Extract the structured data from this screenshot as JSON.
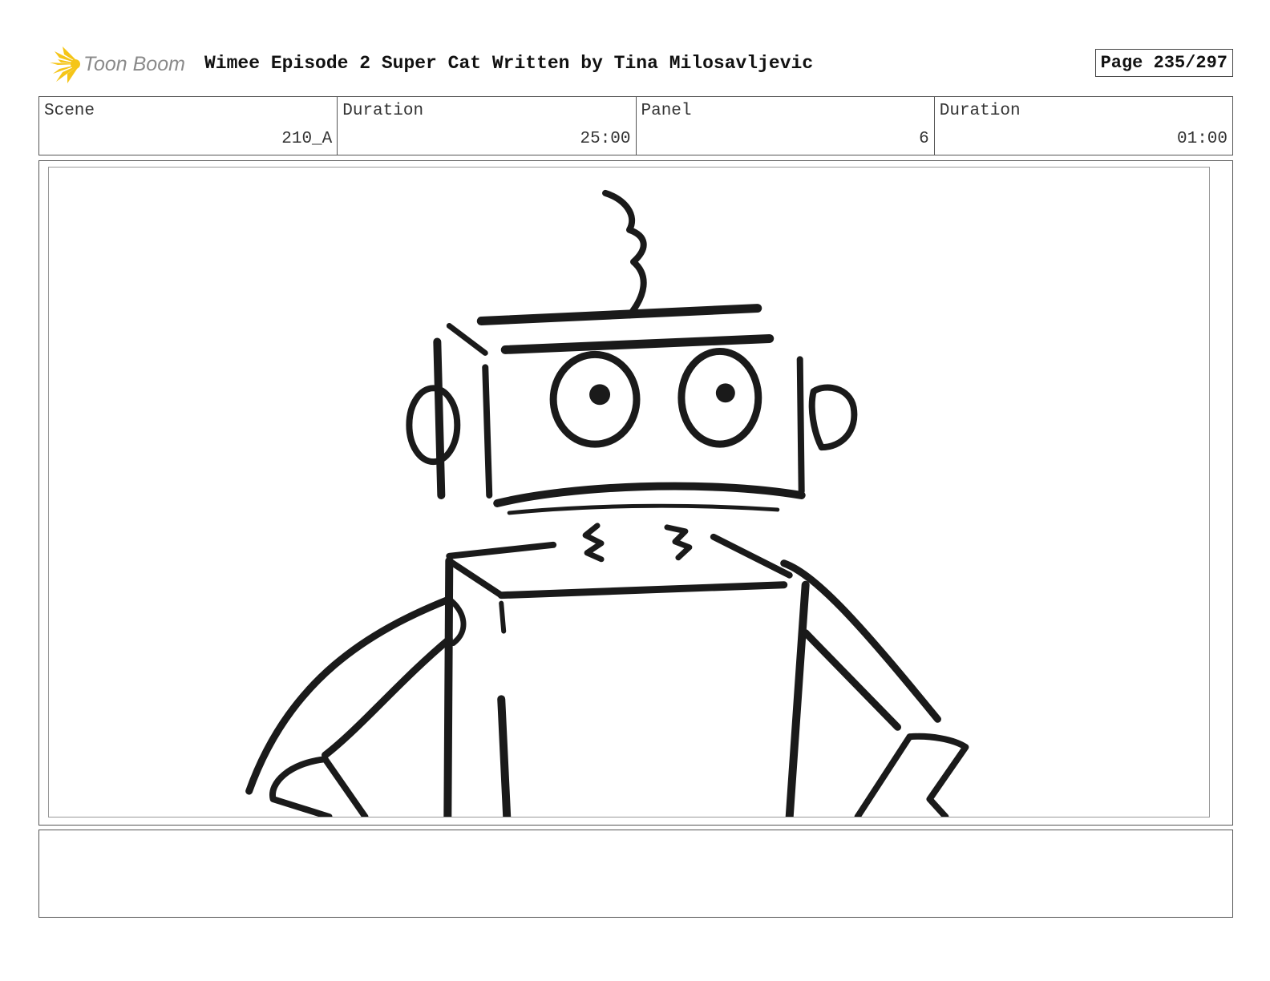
{
  "header": {
    "logo_text": "Toon Boom",
    "title": "Wimee Episode 2 Super Cat  Written by Tina Milosavljevic",
    "page": "Page 235/297"
  },
  "info": {
    "scene_label": "Scene",
    "scene_value": "210_A",
    "scene_duration_label": "Duration",
    "scene_duration_value": "25:00",
    "panel_label": "Panel",
    "panel_value": "6",
    "panel_duration_label": "Duration",
    "panel_duration_value": "01:00"
  },
  "colors": {
    "logo_yellow": "#f5c518",
    "logo_text": "#8a8a8a",
    "sketch_ink": "#1a1a1a"
  },
  "notes": {
    "text": ""
  }
}
